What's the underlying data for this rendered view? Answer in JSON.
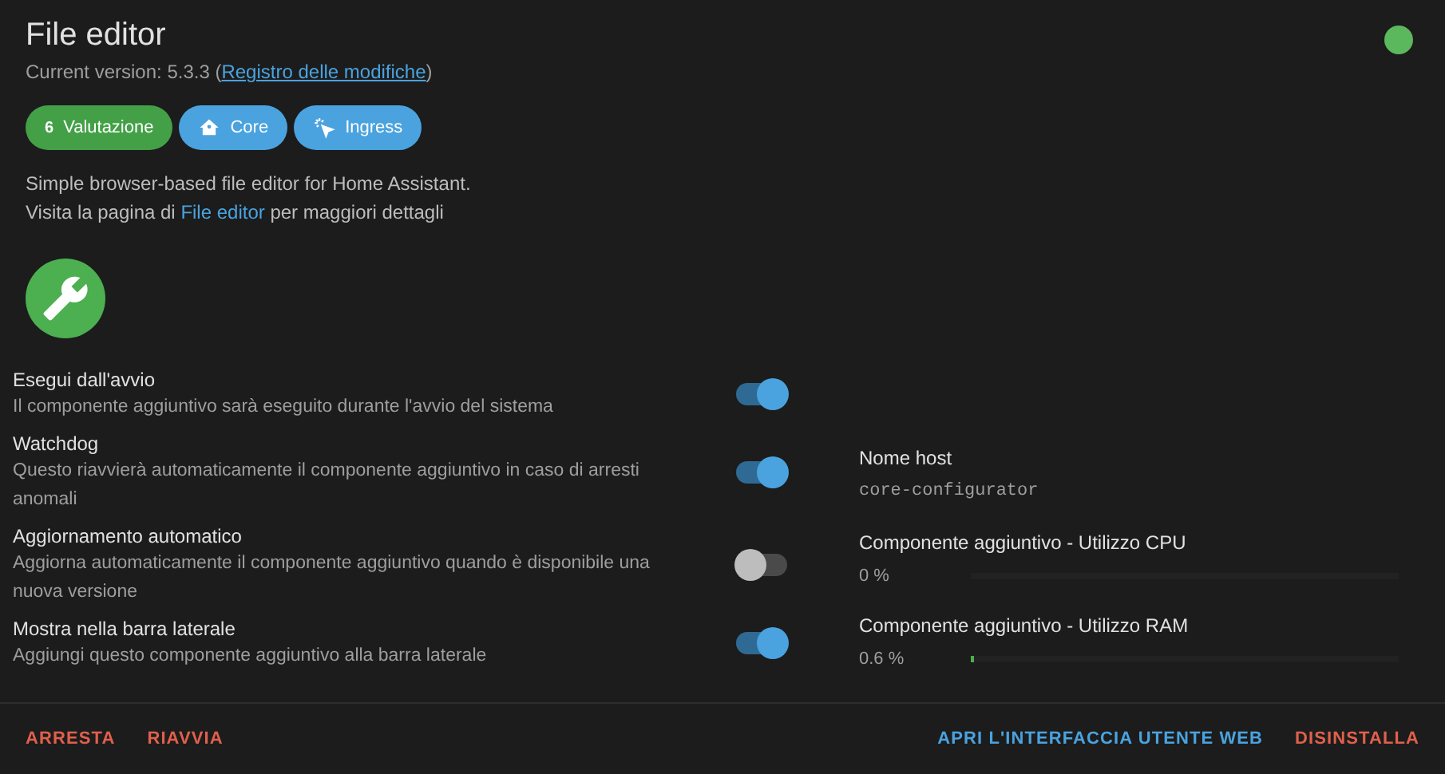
{
  "header": {
    "title": "File editor",
    "version_prefix": "Current version: 5.3.3 (",
    "changelog_link": "Registro delle modifiche",
    "version_suffix": ")",
    "running": true
  },
  "chips": [
    {
      "kind": "rating",
      "badge": "6",
      "label": "Valutazione"
    },
    {
      "kind": "core",
      "label": "Core"
    },
    {
      "kind": "ingress",
      "label": "Ingress"
    }
  ],
  "description": {
    "line_1": "Simple browser-based file editor for Home Assistant.",
    "line_2_prefix": "Visita la pagina di ",
    "line_2_link": "File editor",
    "line_2_suffix": " per maggiori dettagli"
  },
  "options": [
    {
      "title": "Esegui dall'avvio",
      "description": "Il componente aggiuntivo sarà eseguito durante l'avvio del sistema",
      "on": true
    },
    {
      "title": "Watchdog",
      "description": "Questo riavvierà automaticamente il componente aggiuntivo in caso di arresti anomali",
      "on": true
    },
    {
      "title": "Aggiornamento automatico",
      "description": "Aggiorna automaticamente il componente aggiuntivo quando è disponibile una nuova versione",
      "on": false
    },
    {
      "title": "Mostra nella barra laterale",
      "description": "Aggiungi questo componente aggiuntivo alla barra laterale",
      "on": true
    }
  ],
  "hostname": {
    "label": "Nome host",
    "value": "core-configurator"
  },
  "meters": [
    {
      "label": "Componente aggiuntivo - Utilizzo CPU",
      "reading": "0 %",
      "level": 0
    },
    {
      "label": "Componente aggiuntivo - Utilizzo RAM",
      "reading": "0.6 %",
      "level": 0.006
    }
  ],
  "footer": {
    "left": [
      {
        "label": "ARRESTA",
        "color": "#e0604c"
      },
      {
        "label": "RIAVVIA",
        "color": "#e0604c"
      }
    ],
    "right": [
      {
        "label": "APRI L'INTERFACCIA UTENTE WEB",
        "color": "#4aa3df"
      },
      {
        "label": "DISINSTALLA",
        "color": "#e0604c"
      }
    ]
  }
}
